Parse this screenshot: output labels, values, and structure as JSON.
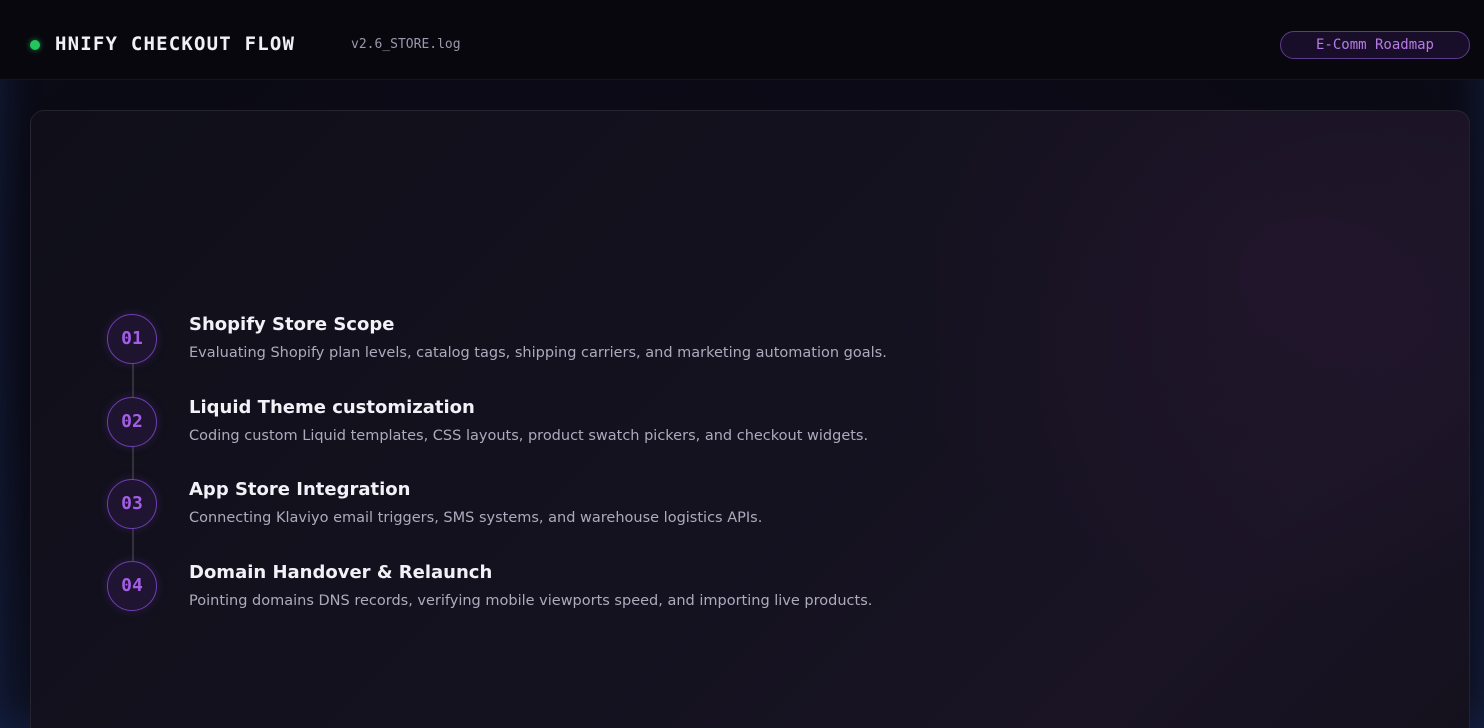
{
  "header": {
    "title": "HNIFY CHECKOUT FLOW",
    "version": "v2.6_STORE.log",
    "badge": "E-Comm Roadmap",
    "status_color": "#22c55e"
  },
  "steps": [
    {
      "number": "01",
      "title": "Shopify Store Scope",
      "description": "Evaluating Shopify plan levels, catalog tags, shipping carriers, and marketing automation goals."
    },
    {
      "number": "02",
      "title": "Liquid Theme customization",
      "description": "Coding custom Liquid templates, CSS layouts, product swatch pickers, and checkout widgets."
    },
    {
      "number": "03",
      "title": "App Store Integration",
      "description": "Connecting Klaviyo email triggers, SMS systems, and warehouse logistics APIs."
    },
    {
      "number": "04",
      "title": "Domain Handover & Relaunch",
      "description": "Pointing domains DNS records, verifying mobile viewports speed, and importing live products."
    }
  ],
  "colors": {
    "accent": "#a35ee6",
    "background": "#0a0a12"
  }
}
